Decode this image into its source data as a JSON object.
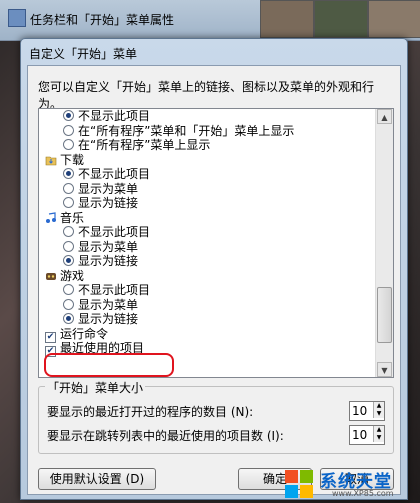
{
  "outer": {
    "title": "任务栏和「开始」菜单属性"
  },
  "dialog": {
    "title": "自定义「开始」菜单",
    "description": "您可以自定义「开始」菜单上的链接、图标以及菜单的外观和行为。"
  },
  "list": {
    "rows": [
      {
        "type": "radio",
        "label": "不显示此项目",
        "checked": true
      },
      {
        "type": "radio",
        "label": "在“所有程序”菜单和「开始」菜单上显示",
        "checked": false
      },
      {
        "type": "radio",
        "label": "在“所有程序”菜单上显示",
        "checked": false
      },
      {
        "type": "category",
        "label": "下载",
        "icon": "downloads-folder-icon"
      },
      {
        "type": "radio",
        "label": "不显示此项目",
        "checked": true
      },
      {
        "type": "radio",
        "label": "显示为菜单",
        "checked": false
      },
      {
        "type": "radio",
        "label": "显示为链接",
        "checked": false
      },
      {
        "type": "category",
        "label": "音乐",
        "icon": "music-note-icon"
      },
      {
        "type": "radio",
        "label": "不显示此项目",
        "checked": false
      },
      {
        "type": "radio",
        "label": "显示为菜单",
        "checked": false
      },
      {
        "type": "radio",
        "label": "显示为链接",
        "checked": true
      },
      {
        "type": "category",
        "label": "游戏",
        "icon": "games-icon"
      },
      {
        "type": "radio",
        "label": "不显示此项目",
        "checked": false
      },
      {
        "type": "radio",
        "label": "显示为菜单",
        "checked": false
      },
      {
        "type": "radio",
        "label": "显示为链接",
        "checked": true
      },
      {
        "type": "checkbox",
        "label": "运行命令",
        "checked": true
      },
      {
        "type": "checkbox",
        "label": "最近使用的项目",
        "checked": true
      }
    ]
  },
  "size_group": {
    "title": "「开始」菜单大小",
    "recent_programs_label": "要显示的最近打开过的程序的数目 (N):",
    "recent_programs_value": "10",
    "jump_list_label": "要显示在跳转列表中的最近使用的项目数 (I):",
    "jump_list_value": "10"
  },
  "buttons": {
    "defaults": "使用默认设置 (D)",
    "ok": "确定",
    "cancel": "取消"
  },
  "watermark": {
    "name": "系统天堂",
    "url": "www.XP85.com"
  },
  "colors": {
    "highlight": "#e0141e",
    "dialog_frame": "#b6c9dd",
    "watermark": "#0a64c8"
  }
}
